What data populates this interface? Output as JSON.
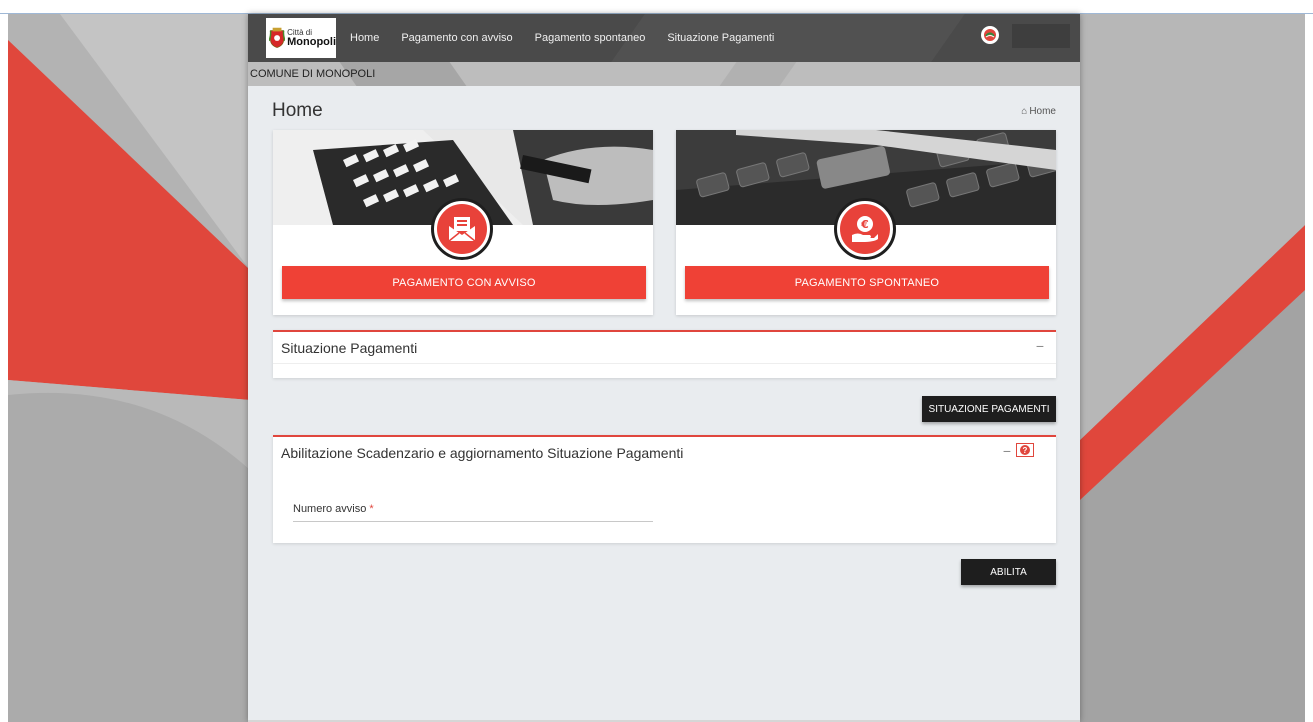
{
  "header": {
    "logo": {
      "small_text": "Città di",
      "big_text": "Monopoli"
    },
    "nav": [
      {
        "label": "Home"
      },
      {
        "label": "Pagamento con avviso"
      },
      {
        "label": "Pagamento spontaneo"
      },
      {
        "label": "Situazione Pagamenti"
      }
    ],
    "subtitle": "COMUNE DI MONOPOLI"
  },
  "page": {
    "title": "Home",
    "breadcrumb": "Home"
  },
  "cards": [
    {
      "button_label": "PAGAMENTO CON AVVISO",
      "icon": "envelope-icon"
    },
    {
      "button_label": "PAGAMENTO SPONTANEO",
      "icon": "euro-hand-icon"
    }
  ],
  "situazione_panel": {
    "title": "Situazione Pagamenti",
    "button_label": "SITUAZIONE PAGAMENTI"
  },
  "abilitazione_panel": {
    "title": "Abilitazione Scadenzario e aggiornamento Situazione Pagamenti",
    "field_label": "Numero avviso",
    "required_mark": "*",
    "field_value": "",
    "button_label": "ABILITA"
  },
  "colors": {
    "accent_red": "#ef4136",
    "navbar": "#4a4a4a",
    "dark_button": "#1e1e1e"
  }
}
